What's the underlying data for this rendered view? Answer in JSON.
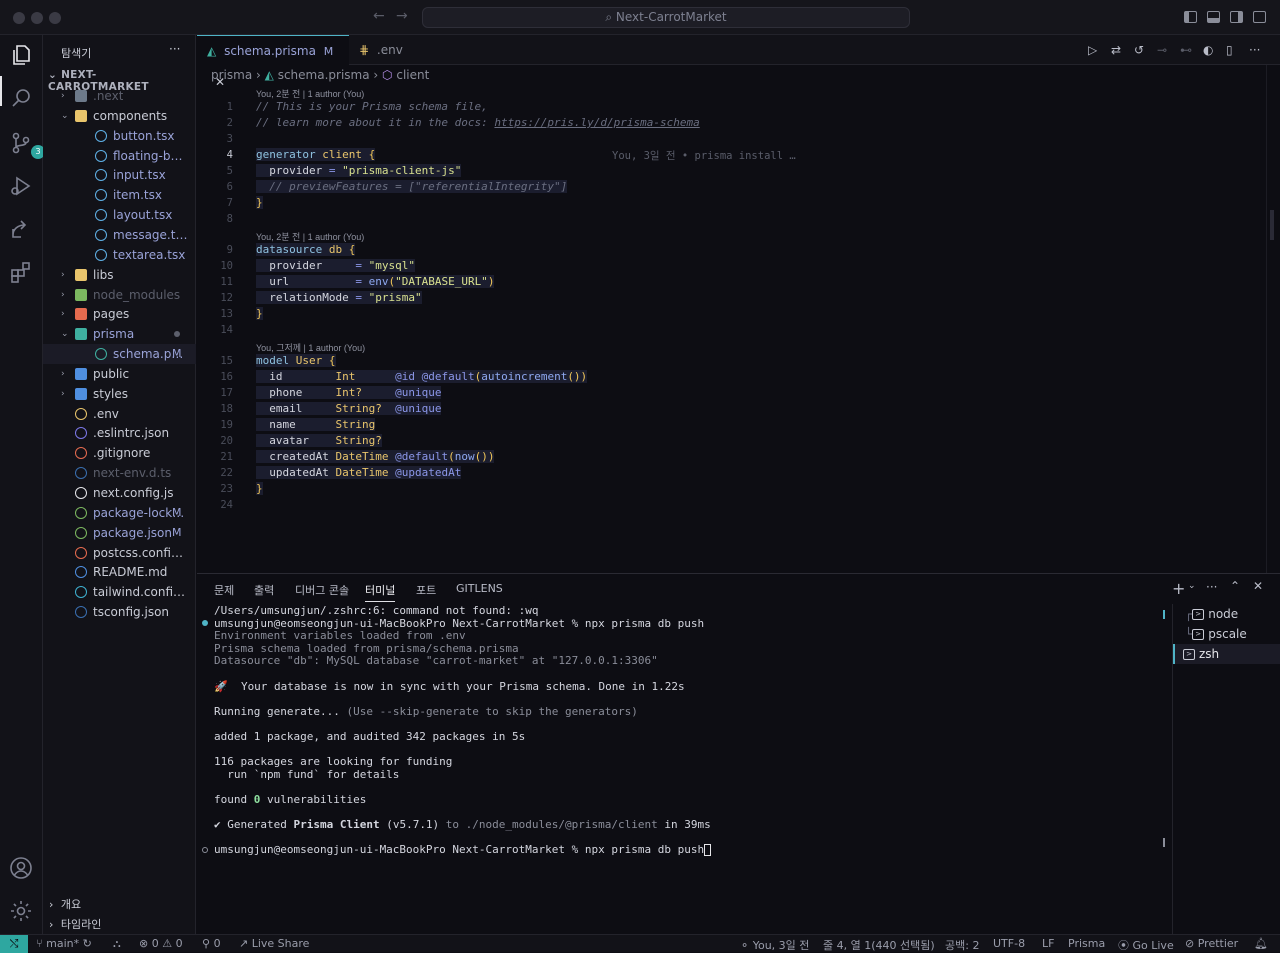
{
  "window": {
    "title": "Next-CarrotMarket"
  },
  "activity_bar": {
    "scm_badge": "3",
    "icons": [
      "explorer-icon",
      "search-icon",
      "source-control-icon",
      "run-debug-icon",
      "remote-icon",
      "extensions-icon",
      "account-icon",
      "settings-gear-icon"
    ]
  },
  "explorer": {
    "title": "탐색기",
    "more": "···",
    "root": "NEXT-CARROTMARKET",
    "items": [
      {
        "label": ".next",
        "color": "#5c5f6c",
        "chev": "›",
        "icon_color": "#6d7a8a"
      },
      {
        "label": "components",
        "color": "#c9ccd6",
        "chev": "⌄",
        "icon_color": "#e9c56c"
      },
      {
        "label": "button.tsx",
        "color": "#9aa3d8",
        "icon_color": "#5fb0e6"
      },
      {
        "label": "floating-button.tsx",
        "color": "#9aa3d8",
        "icon_color": "#5fb0e6"
      },
      {
        "label": "input.tsx",
        "color": "#9aa3d8",
        "icon_color": "#5fb0e6"
      },
      {
        "label": "item.tsx",
        "color": "#9aa3d8",
        "icon_color": "#5fb0e6"
      },
      {
        "label": "layout.tsx",
        "color": "#9aa3d8",
        "icon_color": "#5fb0e6"
      },
      {
        "label": "message.tsx",
        "color": "#9aa3d8",
        "icon_color": "#5fb0e6"
      },
      {
        "label": "textarea.tsx",
        "color": "#9aa3d8",
        "icon_color": "#5fb0e6"
      },
      {
        "label": "libs",
        "color": "#c9ccd6",
        "chev": "›",
        "icon_color": "#e9c56c"
      },
      {
        "label": "node_modules",
        "color": "#5c5f6c",
        "chev": "›",
        "icon_color": "#7cb860"
      },
      {
        "label": "pages",
        "color": "#c9ccd6",
        "chev": "›",
        "icon_color": "#e66b4f"
      },
      {
        "label": "prisma",
        "color": "#9aa3d8",
        "chev": "⌄",
        "icon_color": "#3fb0a0"
      },
      {
        "label": "schema.prisma",
        "color": "#9aa3d8",
        "icon_color": "#3fb0a0",
        "mark": "M"
      },
      {
        "label": "public",
        "color": "#c9ccd6",
        "chev": "›",
        "icon_color": "#4f8fe0"
      },
      {
        "label": "styles",
        "color": "#c9ccd6",
        "chev": "›",
        "icon_color": "#4f8fe0"
      },
      {
        "label": ".env",
        "color": "#c9ccd6",
        "icon_color": "#e9c56c"
      },
      {
        "label": ".eslintrc.json",
        "color": "#c9ccd6",
        "icon_color": "#7c78e8"
      },
      {
        "label": ".gitignore",
        "color": "#c9ccd6",
        "icon_color": "#e66b4f"
      },
      {
        "label": "next-env.d.ts",
        "color": "#5c5f6c",
        "icon_color": "#3a6fb0"
      },
      {
        "label": "next.config.js",
        "color": "#c9ccd6",
        "icon_color": "#e6e6ea"
      },
      {
        "label": "package-lock.json",
        "color": "#9aa3d8",
        "icon_color": "#7cb860",
        "mark": "M"
      },
      {
        "label": "package.json",
        "color": "#9aa3d8",
        "icon_color": "#7cb860",
        "mark": "M"
      },
      {
        "label": "postcss.config.js",
        "color": "#c9ccd6",
        "icon_color": "#e66b4f"
      },
      {
        "label": "README.md",
        "color": "#c9ccd6",
        "icon_color": "#4f8fe0"
      },
      {
        "label": "tailwind.config.ts",
        "color": "#c9ccd6",
        "icon_color": "#3fb0d0"
      },
      {
        "label": "tsconfig.json",
        "color": "#c9ccd6",
        "icon_color": "#3a6fb0"
      }
    ],
    "bottom": [
      "개요",
      "타임라인"
    ]
  },
  "editor": {
    "tabs": [
      {
        "label": "schema.prisma",
        "mark": "M"
      },
      {
        "label": ".env"
      }
    ],
    "breadcrumb": [
      "prisma",
      "schema.prisma",
      "client"
    ],
    "lens": [
      "You, 2분 전 | 1 author (You)",
      "You, 2분 전 | 1 author (You)",
      "You, 그저께 | 1 author (You)"
    ],
    "blame": "You, 3일 전 • prisma install …"
  },
  "panel": {
    "tabs": [
      "문제",
      "출력",
      "디버그 콘솔",
      "터미널",
      "포트",
      "GITLENS"
    ],
    "active_tab": "터미널",
    "terminals": [
      "node",
      "pscale",
      "zsh"
    ],
    "lines": [
      "/Users/umsungjun/.zshrc:6: command not found: :wq",
      "umsungjun@eomseongjun-ui-MacBookPro Next-CarrotMarket % npx prisma db push",
      "Environment variables loaded from .env",
      "Prisma schema loaded from prisma/schema.prisma",
      "Datasource \"db\": MySQL database \"carrot-market\" at \"127.0.0.1:3306\"",
      "🚀  Your database is now in sync with your Prisma schema. Done in 1.22s",
      "Running generate...",
      "(Use --skip-generate to skip the generators)",
      "added 1 package, and audited 342 packages in 5s",
      "116 packages are looking for funding",
      "  run `npm fund` for details",
      "found ",
      "0",
      " vulnerabilities",
      "✔ Generated ",
      "Prisma Client",
      " (v5.7.1)",
      " to ./node_modules/@prisma/client",
      " in 39ms",
      "umsungjun@eomseongjun-ui-MacBookPro Next-CarrotMarket % npx prisma db push"
    ]
  },
  "status_bar": {
    "remote": "⤭",
    "branch": "main*",
    "errors": "⊗ 0",
    "warnings": "⚠ 0",
    "ports": "0",
    "live_share": "Live Share",
    "blame": "You, 3일 전",
    "position": "줄 4, 열 1(440 선택됨)",
    "spaces": "공백: 2",
    "encoding": "UTF-8",
    "eol": "LF",
    "language": "Prisma",
    "go_live": "Go Live",
    "prettier": "Prettier"
  }
}
